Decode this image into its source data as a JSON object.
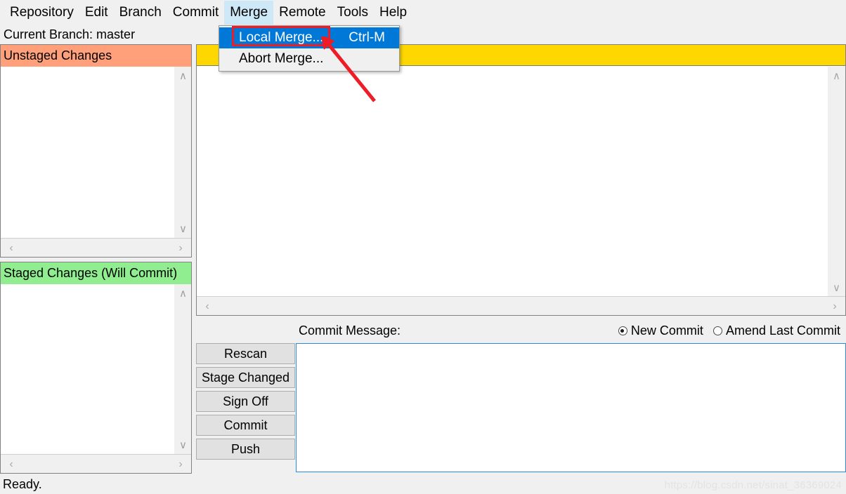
{
  "menubar": {
    "items": [
      {
        "label": "Repository",
        "active": false
      },
      {
        "label": "Edit",
        "active": false
      },
      {
        "label": "Branch",
        "active": false
      },
      {
        "label": "Commit",
        "active": false
      },
      {
        "label": "Merge",
        "active": true
      },
      {
        "label": "Remote",
        "active": false
      },
      {
        "label": "Tools",
        "active": false
      },
      {
        "label": "Help",
        "active": false
      }
    ]
  },
  "dropdown": {
    "open_menu": "Merge",
    "items": [
      {
        "label": "Local Merge...",
        "accel": "Ctrl-M",
        "highlighted": true
      },
      {
        "label": "Abort Merge...",
        "accel": "",
        "highlighted": false
      }
    ]
  },
  "branch_bar": {
    "text": "Current Branch: master"
  },
  "left_panels": {
    "unstaged": {
      "header": "Unstaged Changes",
      "header_color": "#ffa07a",
      "items": []
    },
    "staged": {
      "header": "Staged Changes (Will Commit)",
      "header_color": "#90ee90",
      "items": []
    }
  },
  "diff_panel": {
    "gold_bar_text": "",
    "gold_bar_color": "#ffd700",
    "content": ""
  },
  "commit_bar": {
    "label": "Commit Message:",
    "options": [
      {
        "label": "New Commit",
        "checked": true
      },
      {
        "label": "Amend Last Commit",
        "checked": false
      }
    ]
  },
  "buttons": [
    {
      "label": "Rescan"
    },
    {
      "label": "Stage Changed"
    },
    {
      "label": "Sign Off"
    },
    {
      "label": "Commit"
    },
    {
      "label": "Push"
    }
  ],
  "commit_message": {
    "value": "",
    "placeholder": ""
  },
  "statusbar": {
    "text": "Ready.",
    "watermark": "https://blog.csdn.net/sinat_36369024"
  },
  "annotations": {
    "rect_color": "#ee1c25",
    "arrow_color": "#ee1c25",
    "target": "Local Merge..."
  },
  "icons": {
    "scroll_up": "∧",
    "scroll_down": "∨",
    "scroll_left": "‹",
    "scroll_right": "›"
  }
}
